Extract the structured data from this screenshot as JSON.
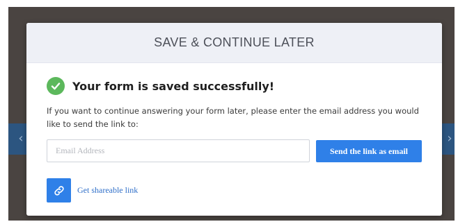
{
  "background": {
    "arrow_left": "‹",
    "arrow_right": "›"
  },
  "modal": {
    "title": "SAVE & CONTINUE LATER",
    "success_message": "Your form is saved successfully!",
    "instructions": "If you want to continue answering your form later, please enter the email address you would like to send the link to:",
    "email_input": {
      "placeholder": "Email Address",
      "value": ""
    },
    "send_button_label": "Send the link as email",
    "share_link_label": "Get shareable link",
    "icons": {
      "success": "check-circle-icon",
      "share": "link-icon"
    }
  },
  "colors": {
    "accent": "#2f80e8",
    "success": "#5cb85c",
    "header_bg": "#eef0f6",
    "overlay": "#4a4441",
    "band": "#2c5580"
  }
}
